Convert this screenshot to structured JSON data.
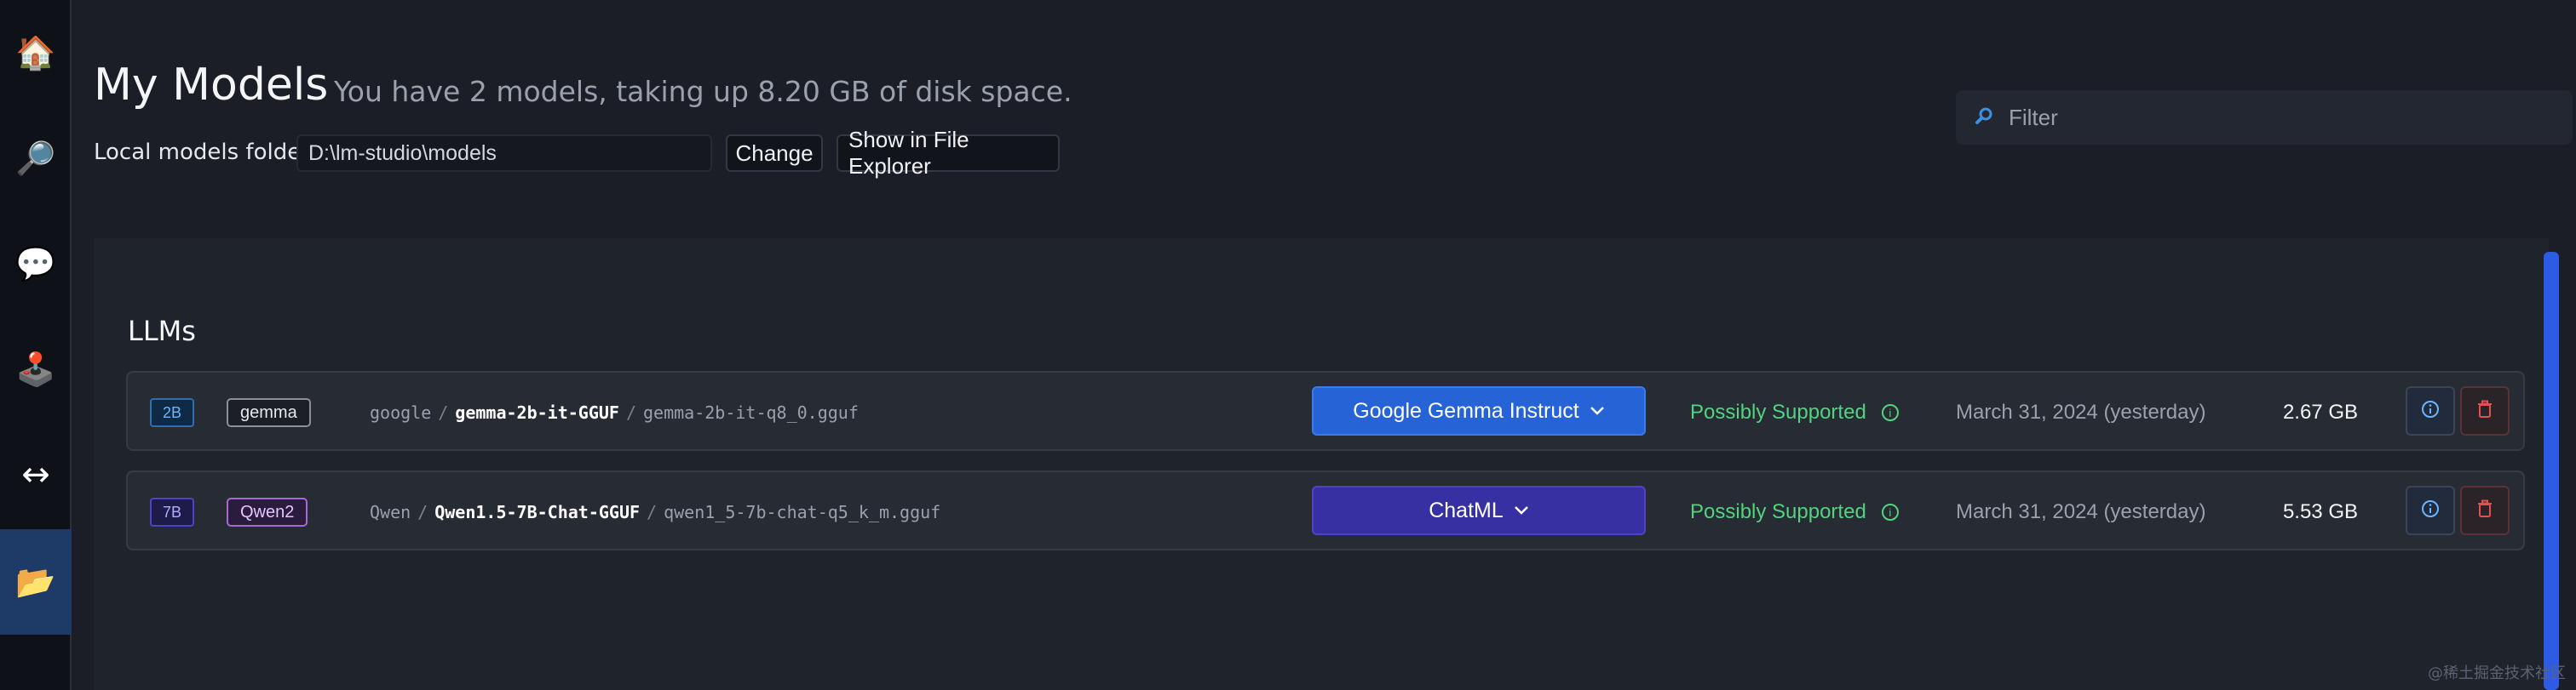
{
  "sidebar": {
    "items": [
      {
        "name": "home",
        "glyph": "🏠"
      },
      {
        "name": "search",
        "glyph": "🔎"
      },
      {
        "name": "chat",
        "glyph": "💬"
      },
      {
        "name": "playground",
        "glyph": "🕹️"
      },
      {
        "name": "server",
        "glyph": "↔"
      },
      {
        "name": "my-models",
        "glyph": "📂",
        "active": true
      }
    ]
  },
  "header": {
    "title": "My Models",
    "subtitle": "You have 2 models, taking up 8.20 GB of disk space.",
    "folder_label": "Local models folder",
    "folder_path": "D:\\lm-studio\\models",
    "change_label": "Change",
    "explorer_label": "Show in File Explorer",
    "filter_placeholder": "Filter"
  },
  "section": {
    "title": "LLMs"
  },
  "models": [
    {
      "size_badge": "2B",
      "family": "gemma",
      "publisher": "google",
      "repo": "gemma-2b-it-GGUF",
      "file": "gemma-2b-it-q8_0.gguf",
      "preset": "Google Gemma Instruct",
      "support": "Possibly Supported",
      "date": "March 31, 2024 (yesterday)",
      "size": "2.67 GB"
    },
    {
      "size_badge": "7B",
      "family": "Qwen2",
      "publisher": "Qwen",
      "repo": "Qwen1.5-7B-Chat-GGUF",
      "file": "qwen1_5-7b-chat-q5_k_m.gguf",
      "preset": "ChatML",
      "support": "Possibly Supported",
      "date": "March 31, 2024 (yesterday)",
      "size": "5.53 GB"
    }
  ],
  "colors": {
    "accent_blue": "#2563d6",
    "accent_indigo": "#3730a3",
    "supported_green": "#53d37f",
    "delete_red": "#e0524f"
  },
  "watermark": "@稀土掘金技术社区"
}
